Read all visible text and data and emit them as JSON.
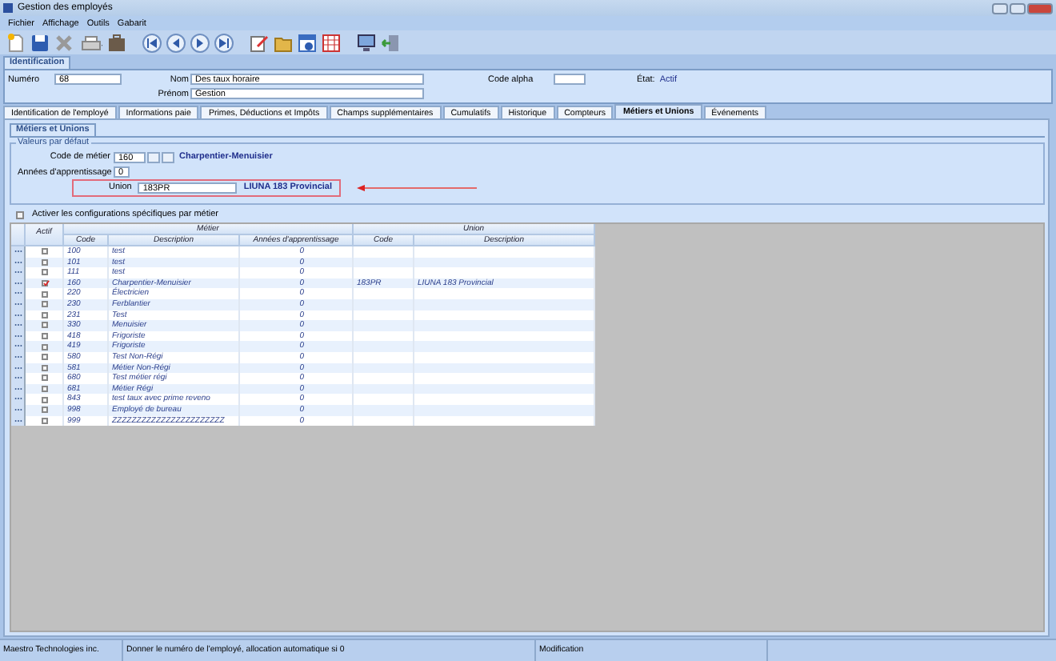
{
  "window": {
    "title": "Gestion des employés"
  },
  "menu": [
    "Fichier",
    "Affichage",
    "Outils",
    "Gabarit"
  ],
  "identification": {
    "tab": "Identification",
    "numero": {
      "label": "Numéro",
      "value": "68"
    },
    "nom": {
      "label": "Nom",
      "value": "Des taux horaire"
    },
    "prenom": {
      "label": "Prénom",
      "value": "Gestion"
    },
    "code_alpha": {
      "label": "Code alpha"
    },
    "etat": {
      "label": "État:",
      "value": "Actif"
    }
  },
  "tabs": [
    {
      "label": "Identification de l'employé",
      "selected": false
    },
    {
      "label": "Informations paie",
      "selected": false
    },
    {
      "label": "Primes, Déductions et Impôts",
      "selected": false
    },
    {
      "label": "Champs supplémentaires",
      "selected": false
    },
    {
      "label": "Cumulatifs",
      "selected": false
    },
    {
      "label": "Historique",
      "selected": false
    },
    {
      "label": "Compteurs",
      "selected": false
    },
    {
      "label": "Métiers et Unions",
      "selected": true
    },
    {
      "label": "Événements",
      "selected": false
    }
  ],
  "panel": {
    "tab": "Métiers et Unions",
    "group_title": "Valeurs par défaut",
    "code_metier": {
      "label": "Code de métier",
      "value": "160",
      "description": "Charpentier-Menuisier"
    },
    "annees": {
      "label": "Années d'apprentissage",
      "value": "0"
    },
    "union": {
      "label": "Union",
      "value": "183PR",
      "description": "LIUNA 183 Provincial",
      "highlighted": true
    },
    "specific_config": {
      "label": "Activer les configurations spécifiques par métier",
      "checked": false
    }
  },
  "table": {
    "actif_header": "Actif",
    "group_headers": [
      "Métier",
      "Union"
    ],
    "columns": [
      "Code",
      "Description",
      "Années d'apprentissage",
      "Code",
      "Description"
    ],
    "rows": [
      {
        "actif": false,
        "cells": [
          "100",
          "test",
          "0",
          "",
          ""
        ]
      },
      {
        "actif": false,
        "cells": [
          "101",
          "test",
          "0",
          "",
          ""
        ]
      },
      {
        "actif": false,
        "cells": [
          "111",
          "test",
          "0",
          "",
          ""
        ]
      },
      {
        "actif": true,
        "cells": [
          "160",
          "Charpentier-Menuisier",
          "0",
          "183PR",
          "LIUNA 183 Provincial"
        ]
      },
      {
        "actif": false,
        "cells": [
          "220",
          "Électricien",
          "0",
          "",
          ""
        ]
      },
      {
        "actif": false,
        "cells": [
          "230",
          "Ferblantier",
          "0",
          "",
          ""
        ]
      },
      {
        "actif": false,
        "cells": [
          "231",
          "Test",
          "0",
          "",
          ""
        ]
      },
      {
        "actif": false,
        "cells": [
          "330",
          "Menuisier",
          "0",
          "",
          ""
        ]
      },
      {
        "actif": false,
        "cells": [
          "418",
          "Frigoriste",
          "0",
          "",
          ""
        ]
      },
      {
        "actif": false,
        "cells": [
          "419",
          "Frigoriste",
          "0",
          "",
          ""
        ]
      },
      {
        "actif": false,
        "cells": [
          "580",
          "Test Non-Régi",
          "0",
          "",
          ""
        ]
      },
      {
        "actif": false,
        "cells": [
          "581",
          "Métier Non-Régi",
          "0",
          "",
          ""
        ]
      },
      {
        "actif": false,
        "cells": [
          "680",
          "Test métier régi",
          "0",
          "",
          ""
        ]
      },
      {
        "actif": false,
        "cells": [
          "681",
          "Métier Régi",
          "0",
          "",
          ""
        ]
      },
      {
        "actif": false,
        "cells": [
          "843",
          "test taux avec prime reveno",
          "0",
          "",
          ""
        ]
      },
      {
        "actif": false,
        "cells": [
          "998",
          "Employé de bureau",
          "0",
          "",
          ""
        ]
      },
      {
        "actif": false,
        "cells": [
          "999",
          "ZZZZZZZZZZZZZZZZZZZZZZZ",
          "0",
          "",
          ""
        ]
      }
    ]
  },
  "status_bar": [
    "Maestro Technologies inc.",
    "Donner le numéro de l'employé, allocation automatique si 0",
    "Modification"
  ]
}
